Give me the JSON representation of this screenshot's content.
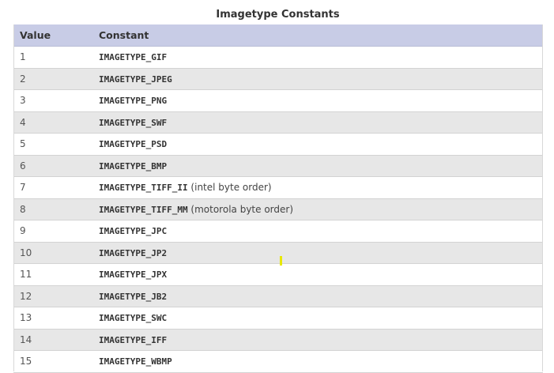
{
  "caption": "Imagetype Constants",
  "headers": {
    "value": "Value",
    "constant": "Constant"
  },
  "rows": [
    {
      "value": "1",
      "constant": "IMAGETYPE_GIF",
      "note": ""
    },
    {
      "value": "2",
      "constant": "IMAGETYPE_JPEG",
      "note": ""
    },
    {
      "value": "3",
      "constant": "IMAGETYPE_PNG",
      "note": ""
    },
    {
      "value": "4",
      "constant": "IMAGETYPE_SWF",
      "note": ""
    },
    {
      "value": "5",
      "constant": "IMAGETYPE_PSD",
      "note": ""
    },
    {
      "value": "6",
      "constant": "IMAGETYPE_BMP",
      "note": ""
    },
    {
      "value": "7",
      "constant": "IMAGETYPE_TIFF_II",
      "note": "(intel byte order)"
    },
    {
      "value": "8",
      "constant": "IMAGETYPE_TIFF_MM",
      "note": "(motorola byte order)"
    },
    {
      "value": "9",
      "constant": "IMAGETYPE_JPC",
      "note": ""
    },
    {
      "value": "10",
      "constant": "IMAGETYPE_JP2",
      "note": ""
    },
    {
      "value": "11",
      "constant": "IMAGETYPE_JPX",
      "note": ""
    },
    {
      "value": "12",
      "constant": "IMAGETYPE_JB2",
      "note": ""
    },
    {
      "value": "13",
      "constant": "IMAGETYPE_SWC",
      "note": ""
    },
    {
      "value": "14",
      "constant": "IMAGETYPE_IFF",
      "note": ""
    },
    {
      "value": "15",
      "constant": "IMAGETYPE_WBMP",
      "note": ""
    }
  ],
  "colors": {
    "header_bg": "#c8cce6",
    "row_stripe": "#e7e7e7",
    "cursor": "#e8e800"
  }
}
